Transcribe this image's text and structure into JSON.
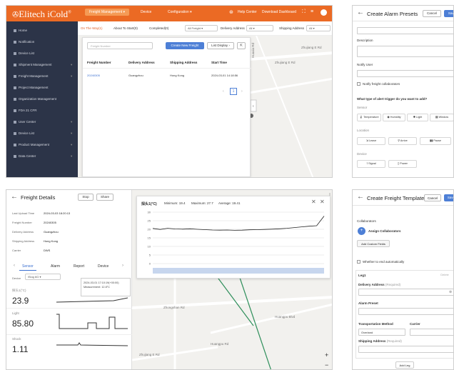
{
  "panel1": {
    "logo": "Elitech iCold",
    "nav": [
      "Freight Management",
      "Device",
      "Configuration",
      "Help Center",
      "Download Dashboard"
    ],
    "sidebar": [
      "Home",
      "Notification",
      "Device List",
      "Shipment Management",
      "Freight Management",
      "Project Management",
      "Organization Management",
      "FDA 21 CFR",
      "User Center",
      "Device List",
      "Product Management",
      "Data Center"
    ],
    "tabs": [
      "On The Way(1)",
      "About To Start(0)",
      "Completed(0)"
    ],
    "filters": {
      "freight": "All Freight",
      "delivery_label": "Delivery Address",
      "delivery_value": "All",
      "shipping_label": "Shipping Address",
      "shipping_value": "All"
    },
    "search_placeholder": "Freight Number",
    "create_button": "Create New Freight",
    "list_display": "List Display",
    "table": {
      "headers": [
        "Freight Number",
        "Delivery Address",
        "Shipping Address",
        "Start Time"
      ],
      "row": [
        "20240305",
        "Guangzhou",
        "Hong Kong",
        "2024-03-01 14:18:56"
      ]
    },
    "page": "1",
    "map_labels": [
      "Zhujiang E Rd",
      "Zhujiang E Rd",
      "Huaxia Rd"
    ]
  },
  "panel2": {
    "title": "Create Alarm Presets",
    "cancel": "Cancel",
    "save": "Save",
    "description": "Description",
    "notify_user": "Notify User",
    "notify_collaborators": "Notify freight collaborators",
    "question": "What type of alert trigger do you want to add?",
    "sensor_label": "Sensor",
    "sensors": [
      "Temperature",
      "Humidity",
      "Light",
      "Window"
    ],
    "location_label": "Location",
    "locations": [
      "Leave",
      "Arrive",
      "Pause"
    ],
    "device_label": "Device",
    "devices": [
      "Signal",
      "Power"
    ]
  },
  "panel3": {
    "title": "Freight Details",
    "stop": "Stop",
    "share": "Share",
    "details": [
      {
        "k": "Last Upload Time",
        "v": "2024-03-03 18:20:13"
      },
      {
        "k": "Freight Number",
        "v": "20240305"
      },
      {
        "k": "Delivery Address",
        "v": "Guangzhou"
      },
      {
        "k": "Shipping Address",
        "v": "Hong Kong"
      },
      {
        "k": "Carrier",
        "v": "DWS"
      }
    ],
    "subtabs": [
      "Sensor",
      "Alarm",
      "Report",
      "Device"
    ],
    "device_label": "Device",
    "device_value": "iSlog 6G",
    "metrics": [
      {
        "name": "探头1(°C)",
        "value": "23.9"
      },
      {
        "name": "Light",
        "value": "85.80"
      },
      {
        "name": "Shock",
        "value": "1.11"
      }
    ],
    "tooltip_time": "2024-03-01 17:10:19(+00:00)",
    "tooltip_measure": "Measurement: 12.8°C",
    "chart_title": "探头1(°C)",
    "chart_min": "Minimum: 19.4",
    "chart_max": "Maximum: 27.7",
    "chart_avg": "Average: 19.41",
    "map_labels": [
      "Zhongshan Rd",
      "Huangpu Rd",
      "Huangpu Blvd",
      "Zhujiang E Rd"
    ]
  },
  "panel4": {
    "title": "Create Freight Template",
    "cancel": "Cancel",
    "save": "Save",
    "collaborators_label": "Collaborators",
    "assign": "Assign Collaborators",
    "add_custom": "Add Custom Fields",
    "auto_end": "Whether to end automatically",
    "leg": "Leg1",
    "delete": "Delete",
    "delivery_label": "Delivery Address",
    "required": "(Required)",
    "alarm_preset": "Alarm Preset",
    "transport_label": "Transportation Method",
    "carrier_label": "Carrier",
    "transport_value": "Overland",
    "shipping_label": "Shipping Address",
    "add_leg": "Add Leg"
  },
  "chart_data": {
    "type": "line",
    "title": "探头1(°C)",
    "ylim": [
      0,
      30
    ],
    "y_ticks": [
      0,
      5,
      10,
      15,
      20,
      25,
      30
    ],
    "series": [
      {
        "values": [
          20.5,
          19.9,
          20.6,
          20.2,
          20.1,
          20.3,
          20.0,
          19.8,
          19.6,
          19.5,
          19.6,
          19.4,
          19.5,
          19.7,
          19.8,
          19.9,
          20.1,
          20.3,
          20.6,
          21.0,
          21.4,
          21.8,
          22.1,
          27.7
        ]
      }
    ]
  },
  "colors": {
    "brand": "#eb6a24",
    "sidebar": "#2c3448",
    "primary": "#4d7fd6"
  }
}
